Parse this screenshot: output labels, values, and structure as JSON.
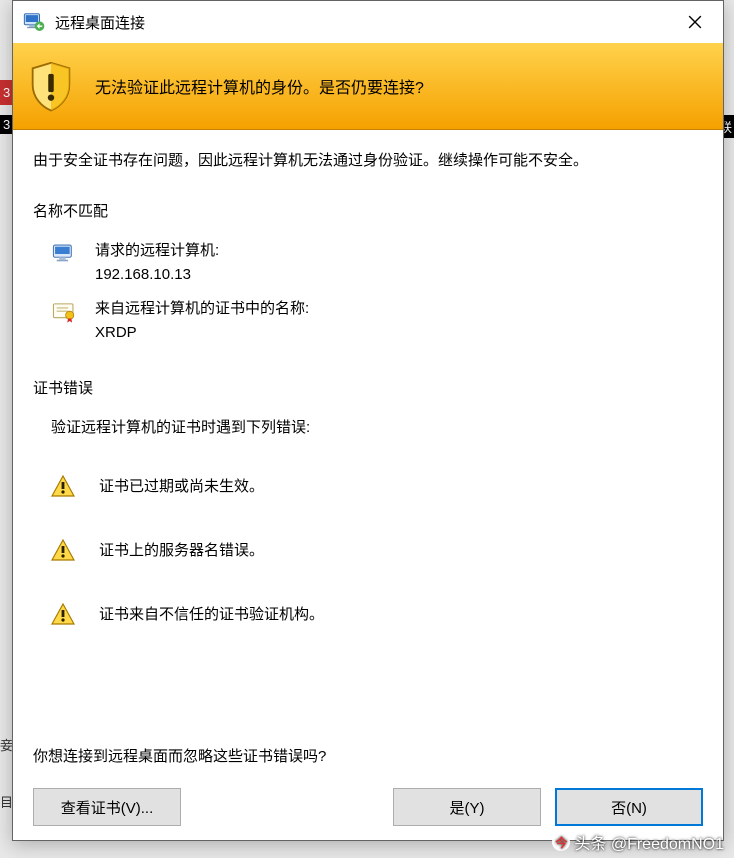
{
  "window": {
    "title": "远程桌面连接"
  },
  "banner": {
    "message": "无法验证此远程计算机的身份。是否仍要连接?"
  },
  "lead": "由于安全证书存在问题，因此远程计算机无法通过身份验证。继续操作可能不安全。",
  "name_mismatch": {
    "title": "名称不匹配",
    "requested_label": "请求的远程计算机:",
    "requested_value": "192.168.10.13",
    "cert_name_label": "来自远程计算机的证书中的名称:",
    "cert_name_value": "XRDP"
  },
  "cert_errors": {
    "title": "证书错误",
    "intro": "验证远程计算机的证书时遇到下列错误:",
    "items": [
      "证书已过期或尚未生效。",
      "证书上的服务器名错误。",
      "证书来自不信任的证书验证机构。"
    ]
  },
  "question": "你想连接到远程桌面而忽略这些证书错误吗?",
  "buttons": {
    "view_cert": "查看证书(V)...",
    "yes": "是(Y)",
    "no": "否(N)"
  },
  "watermark": "头条 @FreedomNO1",
  "bg": {
    "a": "3",
    "b": "3",
    "c": "联",
    "d": "妾",
    "e": "目"
  }
}
